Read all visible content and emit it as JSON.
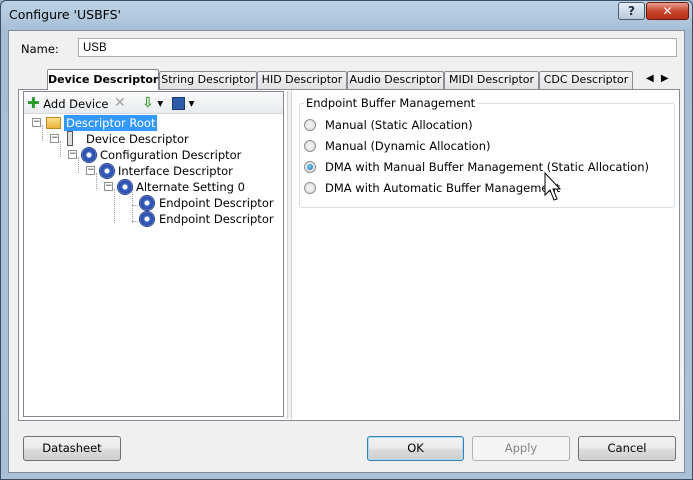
{
  "window": {
    "title": "Configure 'USBFS'",
    "help_label": "?",
    "close_label": "✕"
  },
  "name_field": {
    "label": "Name:",
    "value": "USB"
  },
  "tabs": [
    {
      "label": "Device Descriptor",
      "active": true
    },
    {
      "label": "String Descriptor",
      "active": false
    },
    {
      "label": "HID Descriptor",
      "active": false
    },
    {
      "label": "Audio Descriptor",
      "active": false
    },
    {
      "label": "MIDI Descriptor",
      "active": false
    },
    {
      "label": "CDC Descriptor",
      "active": false
    }
  ],
  "tab_scroll": {
    "left": "◀",
    "right": "▶"
  },
  "toolbar": {
    "add_device_label": "Add Device",
    "delete_icon": "✕",
    "import_icon": "down-arrow-icon",
    "save_icon": "floppy-disk-icon",
    "dropdown_glyph": "▾"
  },
  "tree": {
    "root": "Descriptor Root",
    "device": "Device Descriptor",
    "configuration": "Configuration Descriptor",
    "interface": "Interface Descriptor",
    "alternate": "Alternate Setting 0",
    "endpoint1": "Endpoint Descriptor",
    "endpoint2": "Endpoint Descriptor"
  },
  "buffer_group": {
    "title": "Endpoint Buffer Management",
    "options": [
      {
        "label": "Manual (Static Allocation)",
        "checked": false
      },
      {
        "label": "Manual (Dynamic Allocation)",
        "checked": false
      },
      {
        "label": "DMA with Manual Buffer Management (Static Allocation)",
        "checked": true
      },
      {
        "label": "DMA with Automatic Buffer Management",
        "checked": false
      }
    ]
  },
  "buttons": {
    "datasheet": "Datasheet",
    "ok": "OK",
    "apply": "Apply",
    "cancel": "Cancel"
  }
}
